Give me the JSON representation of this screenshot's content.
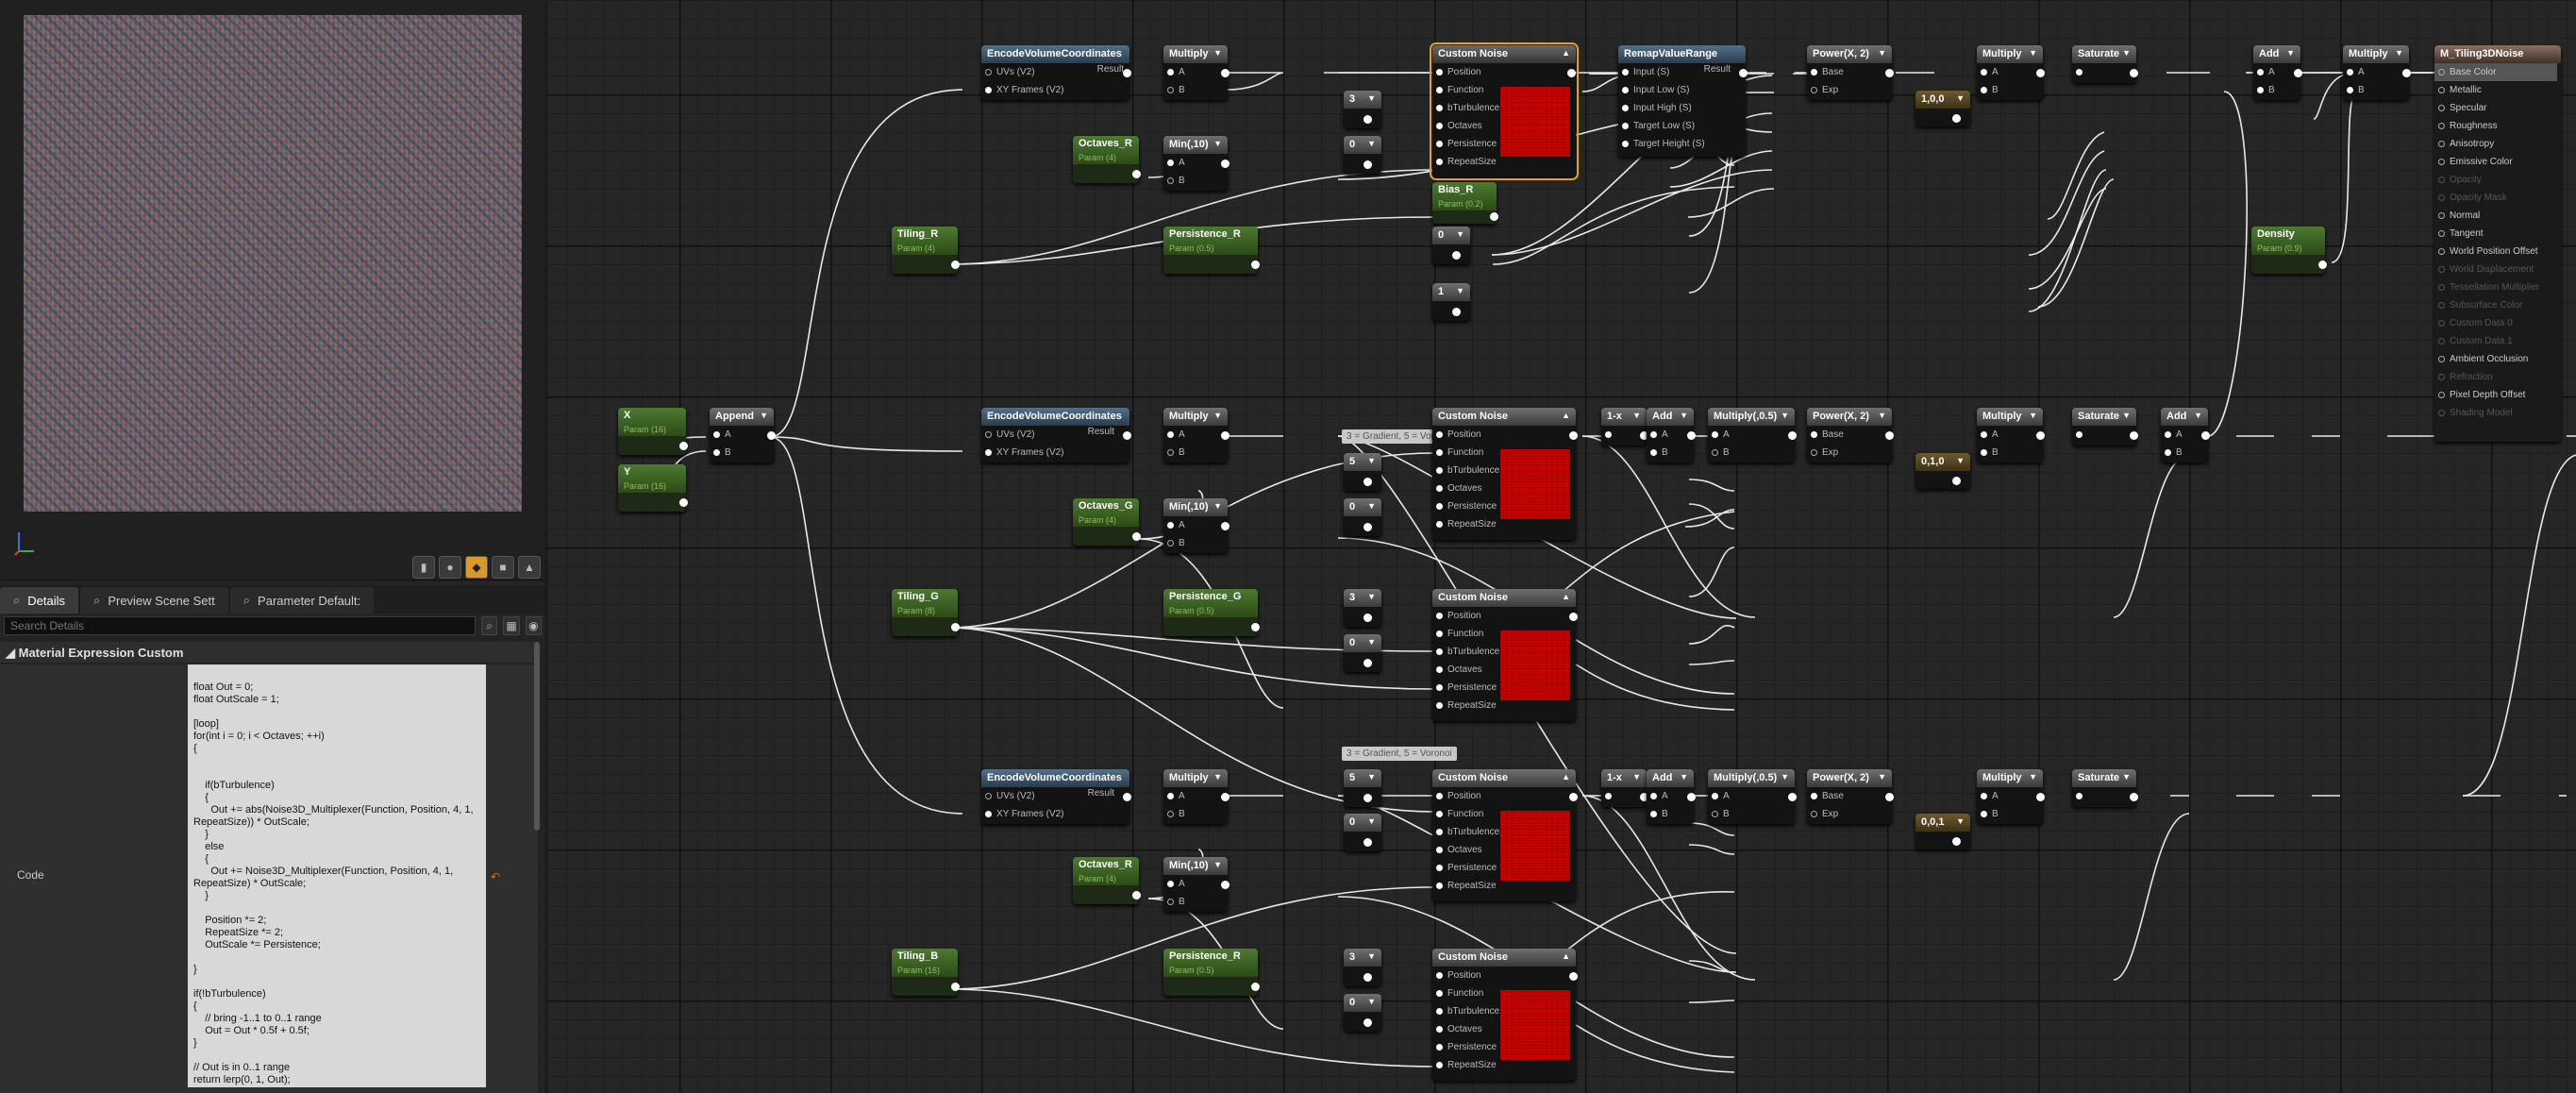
{
  "details_tabs": [
    {
      "label": "Details",
      "icon": "magnifier-icon"
    },
    {
      "label": "Preview Scene Sett",
      "icon": "magnifier-icon"
    },
    {
      "label": "Parameter Default:",
      "icon": "magnifier-icon"
    }
  ],
  "search_placeholder": "Search Details",
  "section_title": "Material Expression Custom",
  "prop_name": "Code",
  "code": "float Out = 0;\nfloat OutScale = 1;\n\n[loop]\nfor(int i = 0; i < Octaves; ++i)\n{\n\n\n    if(bTurbulence)\n    {\n      Out += abs(Noise3D_Multiplexer(Function, Position, 4, 1,\nRepeatSize)) * OutScale;\n    }\n    else\n    {\n      Out += Noise3D_Multiplexer(Function, Position, 4, 1,\nRepeatSize) * OutScale;\n    }\n\n    Position *= 2;\n    RepeatSize *= 2;\n    OutScale *= Persistence;\n\n}\n\nif(!bTurbulence)\n{\n    // bring -1..1 to 0..1 range\n    Out = Out * 0.5f + 0.5f;\n}\n\n// Out is in 0..1 range\nreturn lerp(0, 1, Out);",
  "n": {
    "evc": "EncodeVolumeCoordinates",
    "uvs": "UVs (V2)",
    "xyf": "XY Frames (V2)",
    "result": "Result",
    "mul": "Multiply",
    "a": "A",
    "b": "B",
    "cn": "Custom Noise",
    "pos": "Position",
    "func": "Function",
    "bturb": "bTurbulence",
    "oct": "Octaves",
    "pers": "Persistence",
    "rep": "RepeatSize",
    "remap": "RemapValueRange",
    "inS": "Input (S)",
    "inLow": "Input Low (S)",
    "inHigh": "Input High (S)",
    "tLow": "Target Low (S)",
    "tHigh": "Target Height (S)",
    "pow": "Power(X, 2)",
    "base": "Base",
    "exp": "Exp",
    "sat": "Saturate",
    "add": "Add",
    "min": "Min(,10)",
    "oneminus": "1-x",
    "mulhalf": "Multiply(,0.5)",
    "octR": "Octaves_R",
    "octG": "Octaves_G",
    "octB": "Octaves_R",
    "pOct": "Param (4)",
    "tilR": "Tiling_R",
    "tilG": "Tiling_G",
    "tilB": "Tiling_B",
    "pTilR": "Param (4)",
    "pTilG": "Param (8)",
    "pTilB": "Param (16)",
    "perR": "Persistence_R",
    "perG": "Persistence_G",
    "perB": "Persistence_R",
    "pPer": "Param (0.5)",
    "biasR": "Bias_R",
    "pBias": "Param (0.2)",
    "density": "Density",
    "pDens": "Param (0.9)",
    "x": "X",
    "y": "Y",
    "pX": "Param (16)",
    "pY": "Param (16)",
    "append": "Append",
    "c3": "3",
    "c0": "0",
    "c1": "1",
    "c5": "5",
    "v100": "1,0,0",
    "v010": "0,1,0",
    "v001": "0,0,1",
    "cmt1": "3 = Gradient, 5 = Voronoi",
    "cmt2": "3 = Gradient, 5 = Voronoi",
    "result_node": "M_Tiling3DNoise"
  },
  "result_pins": [
    {
      "label": "Base Color",
      "on": true
    },
    {
      "label": "Metallic",
      "on": true
    },
    {
      "label": "Specular",
      "on": true
    },
    {
      "label": "Roughness",
      "on": true
    },
    {
      "label": "Anisotropy",
      "on": true
    },
    {
      "label": "Emissive Color",
      "on": true
    },
    {
      "label": "Opacity",
      "on": false
    },
    {
      "label": "Opacity Mask",
      "on": false
    },
    {
      "label": "Normal",
      "on": true
    },
    {
      "label": "Tangent",
      "on": true
    },
    {
      "label": "World Position Offset",
      "on": true
    },
    {
      "label": "World Displacement",
      "on": false
    },
    {
      "label": "Tessellation Multiplier",
      "on": false
    },
    {
      "label": "Subsurface Color",
      "on": false
    },
    {
      "label": "Custom Data 0",
      "on": false
    },
    {
      "label": "Custom Data 1",
      "on": false
    },
    {
      "label": "Ambient Occlusion",
      "on": true
    },
    {
      "label": "Refraction",
      "on": false
    },
    {
      "label": "Pixel Depth Offset",
      "on": true
    },
    {
      "label": "Shading Model",
      "on": false
    }
  ]
}
